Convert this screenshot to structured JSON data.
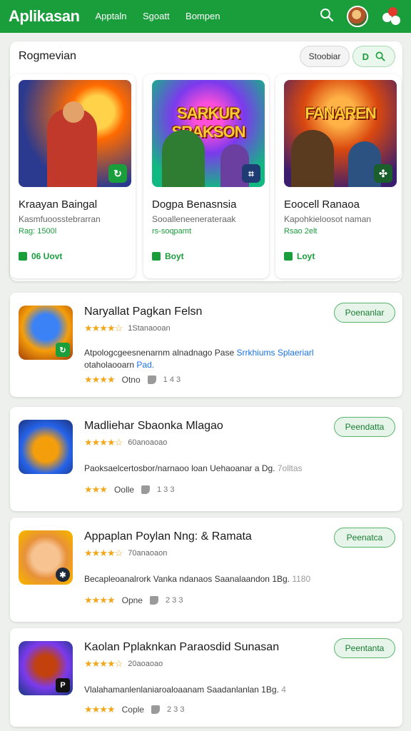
{
  "header": {
    "brand": "Aplikasan",
    "nav": [
      "Apptaln",
      "Sgoatt",
      "Bompen"
    ]
  },
  "panel": {
    "title": "Rogmevian",
    "sort_label": "Stoobiar",
    "search_label": "D"
  },
  "featured": [
    {
      "title": "Kraayan Baingal",
      "desc": "Kasmfuoosstebrarran",
      "price": "Rag: 1500l",
      "action": "06 Uovt",
      "logo": ""
    },
    {
      "title": "Dogpa Benasnsia",
      "desc": "Sooalleneenerateraak",
      "price": "rs-soqpamt",
      "action": "Boyt",
      "logo": "SARKUR SRAKSON"
    },
    {
      "title": "Eoocell Ranaoa",
      "desc": "Kapohkieloosot naman",
      "price": "Rsao 2elt",
      "action": "Loyt",
      "logo": "FANAREN"
    }
  ],
  "list": [
    {
      "title": "Naryallat Pagkan Felsn",
      "rating_text": "1Stanaooan",
      "desc": "Atpologcgeesnenarnm alnadnago Pase",
      "desc_link": "Srrkhiums Splaeriarl",
      "desc2": "otaholaooarn",
      "desc2_link": "Pad.",
      "meta_label": "Otno",
      "meta_count": "1 4 3",
      "button": "Poenanlar"
    },
    {
      "title": "Madliehar Sbaonka Mlagao",
      "rating_text": "60anoaoao",
      "desc": "Paoksaelcertosbor/narnaoo loan Uehaoanar a Dg.",
      "desc_muted": "7olltas",
      "meta_label": "Oolle",
      "meta_count": "1 3 3",
      "button": "Peendatta"
    },
    {
      "title": "Appaplan Poylan Nng: & Ramata",
      "rating_text": "70anaoaon",
      "desc": "Becapleoanalrork Vanka ndanaos Saanalaandon 1Bg.",
      "desc_muted": "1180",
      "meta_label": "Opne",
      "meta_count": "2 3 3",
      "button": "Peenatca"
    },
    {
      "title": "Kaolan Pplaknkan Paraosdid Sunasan",
      "rating_text": "20aoaoao",
      "desc": "Vlalahamanlenlaniaroaloaanam Saadanlanlan 1Bg.",
      "desc_muted": "4",
      "meta_label": "Cople",
      "meta_count": "2 3 3",
      "button": "Peentanta"
    }
  ],
  "colors": {
    "brand": "#1a9e3c",
    "star": "#f2a81d",
    "link": "#1a73e8"
  }
}
